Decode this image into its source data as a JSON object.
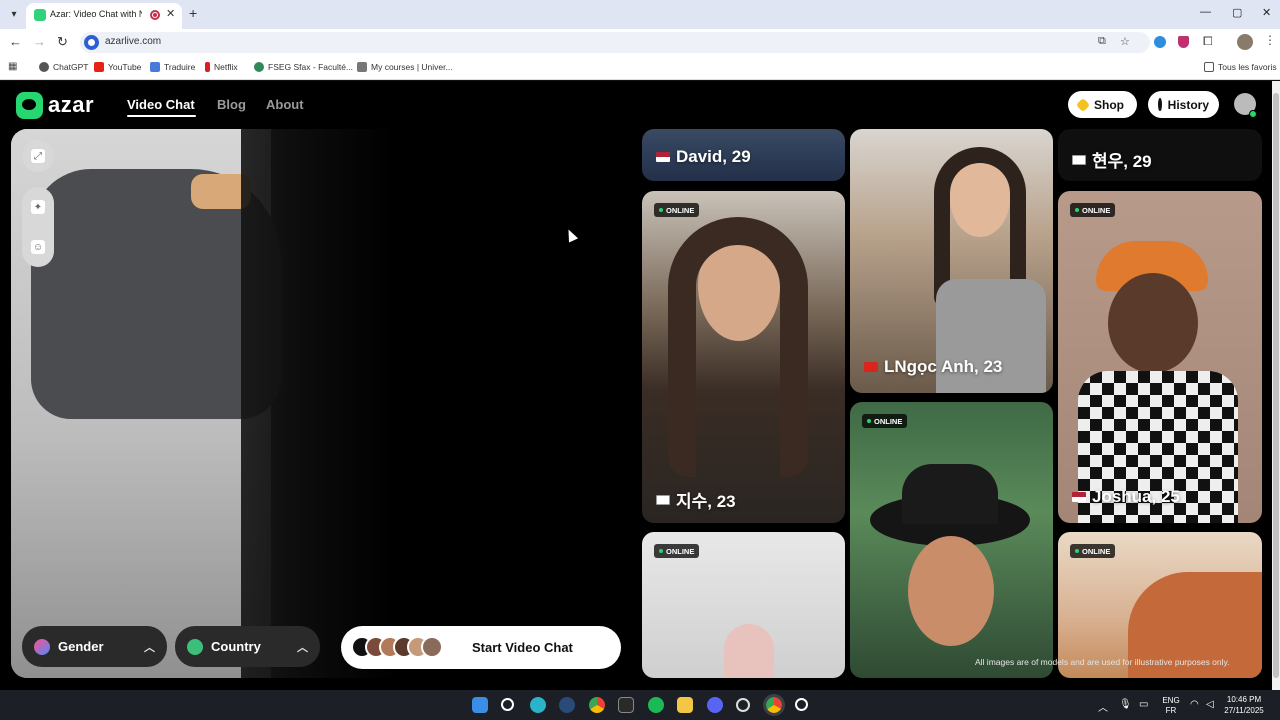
{
  "browser": {
    "tab_title": "Azar: Video Chat with New",
    "tab_close": "✕",
    "new_tab": "+",
    "url": "azarlive.com",
    "window_controls": {
      "minimize": "—",
      "maximize": "▢",
      "close": "✕"
    },
    "bookmarks": [
      {
        "label": "ChatGPT",
        "icon_color": "#555555"
      },
      {
        "label": "YouTube",
        "icon_color": "#e62117"
      },
      {
        "label": "Traduire",
        "icon_color": "#4a79d9"
      },
      {
        "label": "Netflix",
        "icon_color": "#d81f26"
      },
      {
        "label": "FSEG Sfax - Faculté...",
        "icon_color": "#2e8a57"
      },
      {
        "label": "My courses | Univer...",
        "icon_color": "#777777"
      }
    ],
    "all_bookmarks_label": "Tous les favoris"
  },
  "site": {
    "logo_text": "azar",
    "nav": {
      "video_chat": "Video Chat",
      "blog": "Blog",
      "about": "About"
    },
    "shop_label": "Shop",
    "history_label": "History",
    "accent": "#26d66f"
  },
  "video_panel": {
    "gender_label": "Gender",
    "country_label": "Country",
    "start_label": "Start Video Chat"
  },
  "gallery": {
    "online_badge": "ONLINE",
    "cards": [
      {
        "name": "David, 29",
        "flag": "US"
      },
      {
        "name": "현우, 29",
        "flag": "KR"
      },
      {
        "name": "지수, 23",
        "flag": "KR"
      },
      {
        "name": "LNgọc Anh, 23",
        "flag": "VN"
      },
      {
        "name": "Joshua, 25",
        "flag": "US"
      }
    ],
    "disclaimer": "All images are of models and are used for illustrative purposes only."
  },
  "taskbar": {
    "language": "ENG",
    "layout": "FR",
    "time": "10:46 PM",
    "date": "27/11/2025"
  }
}
